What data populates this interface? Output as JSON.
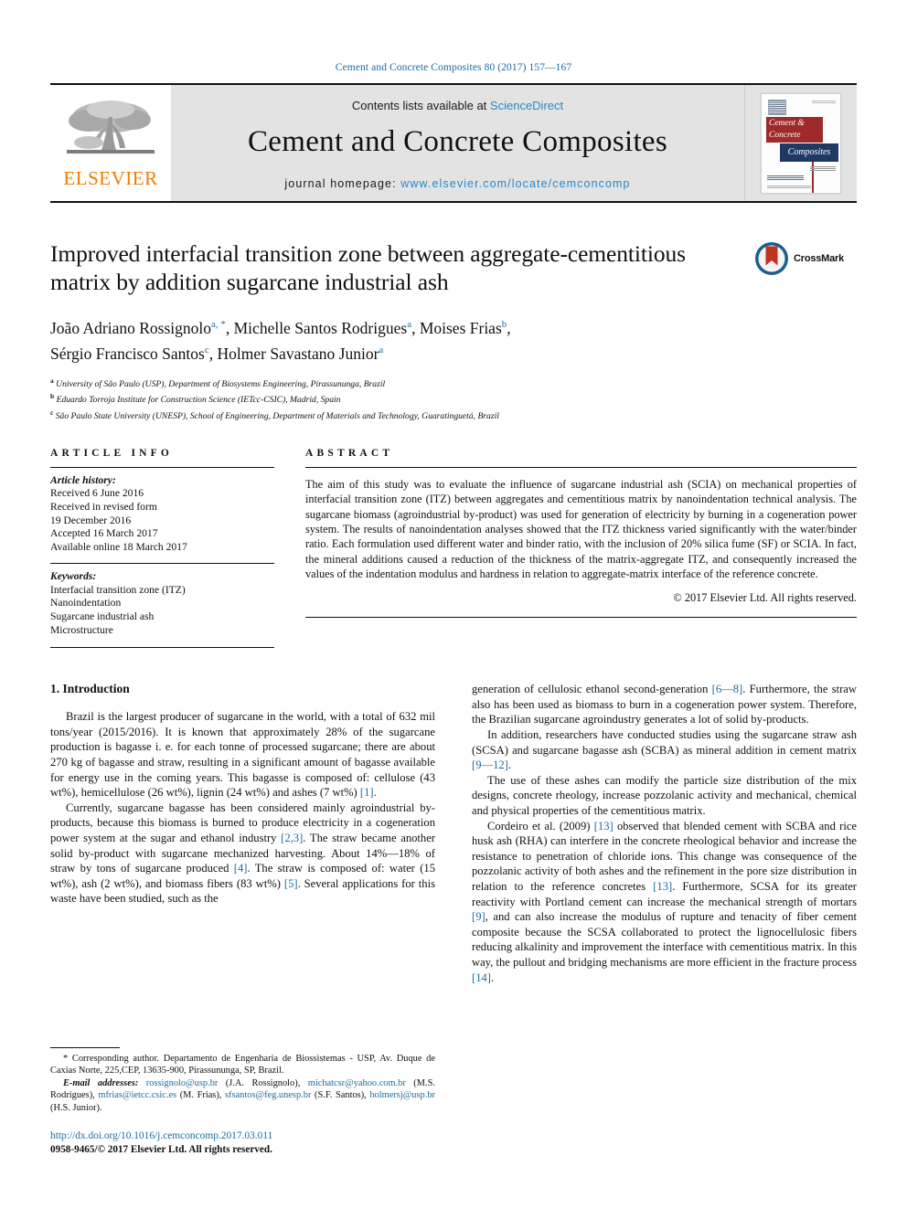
{
  "running_head": "Cement and Concrete Composites 80 (2017) 157—167",
  "masthead": {
    "contents_prefix": "Contents lists available at",
    "sciencedirect": "ScienceDirect",
    "journal_name": "Cement and Concrete Composites",
    "homepage_label": "journal homepage:",
    "homepage_url": "www.elsevier.com/locate/cemconcomp",
    "publisher_logo_word": "ELSEVIER",
    "cover": {
      "line1": "Cement &",
      "line2": "Concrete",
      "line3": "Composites"
    },
    "colors": {
      "link": "#2a87c8",
      "elsevier_orange": "#ef7d00",
      "cover_red": "#9e2a2b",
      "cover_navy": "#1f3864",
      "masthead_gray": "#e3e3e3"
    }
  },
  "crossmark": {
    "label": "CrossMark"
  },
  "article": {
    "title": "Improved interfacial transition zone between aggregate-cementitious matrix by addition sugarcane industrial ash",
    "authors_line1_a": "João Adriano Rossignolo",
    "authors_line1_a_mark": "a, *",
    "authors_line1_b": ", Michelle Santos Rodrigues",
    "authors_line1_b_mark": "a",
    "authors_line1_c": ", Moises Frias",
    "authors_line1_c_mark": "b",
    "authors_line1_end": ",",
    "authors_line2_a": "Sérgio Francisco Santos",
    "authors_line2_a_mark": "c",
    "authors_line2_b": ", Holmer Savastano Junior",
    "authors_line2_b_mark": "a",
    "affiliations": [
      {
        "mark": "a",
        "text": "University of São Paulo (USP), Department of Biosystems Engineering, Pirassununga, Brazil"
      },
      {
        "mark": "b",
        "text": "Eduardo Torroja Institute for Construction Science (IETcc-CSIC), Madrid, Spain"
      },
      {
        "mark": "c",
        "text": "São Paulo State University (UNESP), School of Engineering, Department of Materials and Technology, Guaratinguetá, Brazil"
      }
    ]
  },
  "article_info": {
    "heading": "ARTICLE INFO",
    "history_label": "Article history:",
    "history": [
      "Received 6 June 2016",
      "Received in revised form",
      "19 December 2016",
      "Accepted 16 March 2017",
      "Available online 18 March 2017"
    ],
    "keywords_label": "Keywords:",
    "keywords": [
      "Interfacial transition zone (ITZ)",
      "Nanoindentation",
      "Sugarcane industrial ash",
      "Microstructure"
    ]
  },
  "abstract": {
    "heading": "ABSTRACT",
    "text": "The aim of this study was to evaluate the influence of sugarcane industrial ash (SCIA) on mechanical properties of interfacial transition zone (ITZ) between aggregates and cementitious matrix by nanoindentation technical analysis. The sugarcane biomass (agroindustrial by-product) was used for generation of electricity by burning in a cogeneration power system. The results of nanoindentation analyses showed that the ITZ thickness varied significantly with the water/binder ratio. Each formulation used different water and binder ratio, with the inclusion of 20% silica fume (SF) or SCIA. In fact, the mineral additions caused a reduction of the thickness of the matrix-aggregate ITZ, and consequently increased the values of the indentation modulus and hardness in relation to aggregate-matrix interface of the reference concrete.",
    "copyright": "© 2017 Elsevier Ltd. All rights reserved."
  },
  "body": {
    "section_heading": "1. Introduction",
    "left_paragraphs": [
      {
        "parts": [
          {
            "t": "Brazil is the largest producer of sugarcane in the world, with a total of 632 mil tons/year (2015/2016). It is known that approximately 28% of the sugarcane production is bagasse i. e. for each tonne of processed sugarcane; there are about 270 kg of bagasse and straw, resulting in a significant amount of bagasse available for energy use in the coming years. This bagasse is composed of: cellulose (43 wt%), hemicellulose (26 wt%), lignin (24 wt%) and ashes (7 wt%) "
          },
          {
            "t": "[1]",
            "ref": true
          },
          {
            "t": "."
          }
        ]
      },
      {
        "parts": [
          {
            "t": "Currently, sugarcane bagasse has been considered mainly agroindustrial by-products, because this biomass is burned to produce electricity in a cogeneration power system at the sugar and ethanol industry "
          },
          {
            "t": "[2,3]",
            "ref": true
          },
          {
            "t": ". The straw became another solid by-product with sugarcane mechanized harvesting. About 14%—18% of straw by tons of sugarcane produced "
          },
          {
            "t": "[4]",
            "ref": true
          },
          {
            "t": ". The straw is composed of: water (15 wt%), ash (2 wt%), and biomass fibers (83 wt%) "
          },
          {
            "t": "[5]",
            "ref": true
          },
          {
            "t": ". Several applications for this waste have been studied, such as the"
          }
        ]
      }
    ],
    "right_paragraphs": [
      {
        "continuation": true,
        "parts": [
          {
            "t": "generation of cellulosic ethanol second-generation "
          },
          {
            "t": "[6—8]",
            "ref": true
          },
          {
            "t": ". Furthermore, the straw also has been used as biomass to burn in a cogeneration power system. Therefore, the Brazilian sugarcane agroindustry generates a lot of solid by-products."
          }
        ]
      },
      {
        "parts": [
          {
            "t": "In addition, researchers have conducted studies using the sugarcane straw ash (SCSA) and sugarcane bagasse ash (SCBA) as mineral addition in cement matrix "
          },
          {
            "t": "[9—12]",
            "ref": true
          },
          {
            "t": "."
          }
        ]
      },
      {
        "parts": [
          {
            "t": "The use of these ashes can modify the particle size distribution of the mix designs, concrete rheology, increase pozzolanic activity and mechanical, chemical and physical properties of the cementitious matrix."
          }
        ]
      },
      {
        "parts": [
          {
            "t": "Cordeiro et al. (2009) "
          },
          {
            "t": "[13]",
            "ref": true
          },
          {
            "t": " observed that blended cement with SCBA and rice husk ash (RHA) can interfere in the concrete rheological behavior and increase the resistance to penetration of chloride ions. This change was consequence of the pozzolanic activity of both ashes and the refinement in the pore size distribution in relation to the reference concretes "
          },
          {
            "t": "[13]",
            "ref": true
          },
          {
            "t": ". Furthermore, SCSA for its greater reactivity with Portland cement can increase the mechanical strength of mortars "
          },
          {
            "t": "[9]",
            "ref": true
          },
          {
            "t": ", and can also increase the modulus of rupture and tenacity of fiber cement composite because the SCSA collaborated to protect the lignocellulosic fibers reducing alkalinity and improvement the interface with cementitious matrix. In this way, the pullout and bridging mechanisms are more efficient in the fracture process "
          },
          {
            "t": "[14]",
            "ref": true
          },
          {
            "t": "."
          }
        ]
      }
    ]
  },
  "footnote": {
    "corresponding": "* Corresponding author. Departamento de Engenharia de Biossistemas - USP, Av. Duque de Caxias Norte, 225,CEP, 13635-900, Pirassununga, SP, Brazil.",
    "email_label": "E-mail addresses:",
    "emails": [
      {
        "addr": "rossignolo@usp.br",
        "who": "(J.A. Rossignolo),"
      },
      {
        "addr": "michatcsr@yahoo.com.br",
        "who": "(M.S. Rodrigues),"
      },
      {
        "addr": "mfrias@ietcc.csic.es",
        "who": "(M. Frias),"
      },
      {
        "addr": "sfsantos@feg.unesp.br",
        "who": "(S.F. Santos),"
      },
      {
        "addr": "holmersj@usp.br",
        "who": "(H.S. Junior)."
      }
    ],
    "doi": "http://dx.doi.org/10.1016/j.cemconcomp.2017.03.011",
    "issn_line": "0958-9465/© 2017 Elsevier Ltd. All rights reserved."
  }
}
